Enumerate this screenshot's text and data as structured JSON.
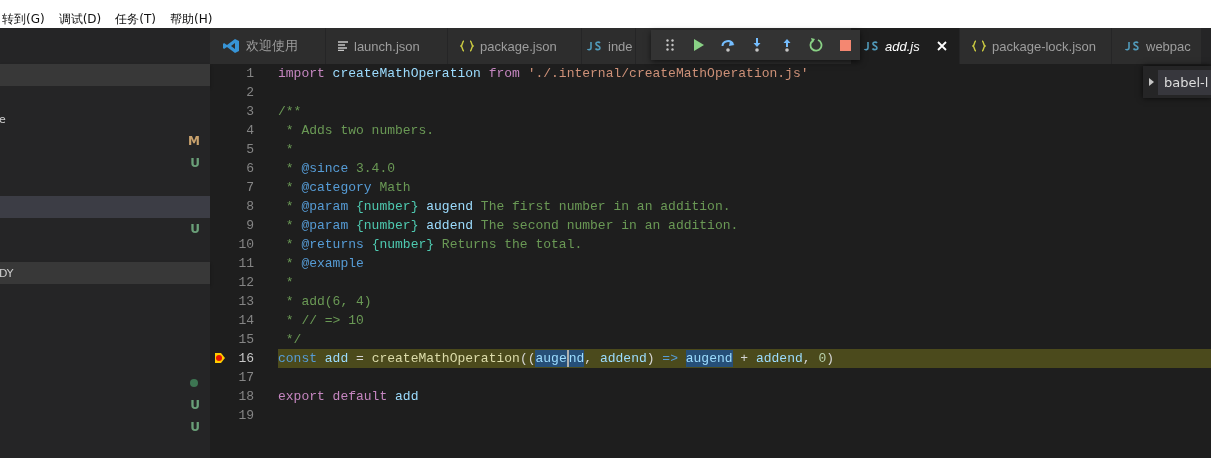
{
  "menu": [
    "转到(G)",
    "调试(D)",
    "任务(T)",
    "帮助(H)"
  ],
  "sidebar": {
    "rows": [
      {
        "kind": "section"
      },
      {
        "kind": "blank"
      },
      {
        "kind": "item",
        "selected": false,
        "text": "e"
      },
      {
        "kind": "item",
        "selected": false,
        "badge": "M",
        "color": "#c9a26d"
      },
      {
        "kind": "item",
        "selected": false,
        "badge": "U",
        "color": "#6a9f78"
      },
      {
        "kind": "blank"
      },
      {
        "kind": "item",
        "selected": true
      },
      {
        "kind": "item",
        "selected": false,
        "badge": "U",
        "color": "#6a9f78"
      },
      {
        "kind": "blank"
      },
      {
        "kind": "section",
        "text": "DY"
      },
      {
        "kind": "blank"
      },
      {
        "kind": "blank"
      },
      {
        "kind": "blank"
      },
      {
        "kind": "blank"
      },
      {
        "kind": "dot",
        "selected": false,
        "color": "#3d7552"
      },
      {
        "kind": "item",
        "selected": false,
        "badge": "U",
        "color": "#6a9f78"
      },
      {
        "kind": "item",
        "selected": false,
        "badge": "U",
        "color": "#6a9f78"
      }
    ]
  },
  "tabs": [
    {
      "label": "欢迎使用",
      "kind": "vscode",
      "selected": false
    },
    {
      "label": "launch.json",
      "kind": "lines",
      "selected": false
    },
    {
      "label": "package.json",
      "kind": "braces",
      "selected": false
    },
    {
      "label": "inde",
      "kind": "js",
      "selected": false
    },
    {
      "label": "add.js",
      "kind": "js",
      "selected": true
    },
    {
      "label": "package-lock.json",
      "kind": "braces",
      "selected": false
    },
    {
      "label": "webpac",
      "kind": "js",
      "selected": false
    }
  ],
  "debug_toolbar": [
    {
      "kind": "grip"
    },
    {
      "kind": "continue"
    },
    {
      "kind": "step-over"
    },
    {
      "kind": "step-into"
    },
    {
      "kind": "step-out"
    },
    {
      "kind": "restart"
    },
    {
      "kind": "stop"
    }
  ],
  "peek": {
    "label": "babel-l"
  },
  "code": [
    {
      "number": "1",
      "tokens": [
        {
          "text": "import",
          "kind": "keyword"
        },
        {
          "text": " createMathOperation",
          "kind": "variable"
        },
        {
          "text": " from",
          "kind": "keyword"
        },
        {
          "text": " './.internal/createMathOperation.js'",
          "kind": "string"
        }
      ]
    },
    {
      "number": "2"
    },
    {
      "number": "3",
      "tokens": [
        {
          "text": "/**",
          "kind": "comment"
        }
      ]
    },
    {
      "number": "4",
      "tokens": [
        {
          "text": " * Adds two numbers.",
          "kind": "comment"
        }
      ]
    },
    {
      "number": "5",
      "tokens": [
        {
          "text": " *",
          "kind": "comment"
        }
      ]
    },
    {
      "number": "6",
      "tokens": [
        {
          "text": " * ",
          "kind": "comment"
        },
        {
          "text": "@since",
          "kind": "tag"
        },
        {
          "text": " 3.4.0",
          "kind": "comment"
        }
      ]
    },
    {
      "number": "7",
      "tokens": [
        {
          "text": " * ",
          "kind": "comment"
        },
        {
          "text": "@category",
          "kind": "tag"
        },
        {
          "text": " Math",
          "kind": "comment"
        }
      ]
    },
    {
      "number": "8",
      "tokens": [
        {
          "text": " * ",
          "kind": "comment"
        },
        {
          "text": "@param",
          "kind": "tag"
        },
        {
          "text": " {number}",
          "kind": "type"
        },
        {
          "text": " augend",
          "kind": "variable"
        },
        {
          "text": " The first number in an addition.",
          "kind": "comment"
        }
      ]
    },
    {
      "number": "9",
      "tokens": [
        {
          "text": " * ",
          "kind": "comment"
        },
        {
          "text": "@param",
          "kind": "tag"
        },
        {
          "text": " {number}",
          "kind": "type"
        },
        {
          "text": " addend",
          "kind": "variable"
        },
        {
          "text": " The second number in an addition.",
          "kind": "comment"
        }
      ]
    },
    {
      "number": "10",
      "tokens": [
        {
          "text": " * ",
          "kind": "comment"
        },
        {
          "text": "@returns",
          "kind": "tag"
        },
        {
          "text": " {number}",
          "kind": "type"
        },
        {
          "text": " Returns the total.",
          "kind": "comment"
        }
      ]
    },
    {
      "number": "11",
      "tokens": [
        {
          "text": " * ",
          "kind": "comment"
        },
        {
          "text": "@example",
          "kind": "tag"
        }
      ]
    },
    {
      "number": "12",
      "tokens": [
        {
          "text": " *",
          "kind": "comment"
        }
      ]
    },
    {
      "number": "13",
      "tokens": [
        {
          "text": " * add(6, 4)",
          "kind": "comment"
        }
      ]
    },
    {
      "number": "14",
      "tokens": [
        {
          "text": " * // => 10",
          "kind": "comment"
        }
      ]
    },
    {
      "number": "15",
      "tokens": [
        {
          "text": " */",
          "kind": "comment"
        }
      ]
    },
    {
      "number": "16",
      "current": true,
      "breakpoint": true,
      "tokens": [
        {
          "text": "const",
          "kind": "storage"
        },
        {
          "text": " add",
          "kind": "variable"
        },
        {
          "text": " = ",
          "kind": "plain"
        },
        {
          "text": "createMathOperation",
          "kind": "function"
        },
        {
          "text": "((",
          "kind": "plain"
        },
        {
          "text": "auge",
          "kind": "variable",
          "highlight": true
        },
        {
          "text": "nd",
          "kind": "variable",
          "highlight": true,
          "cursor": true
        },
        {
          "text": ", ",
          "kind": "plain"
        },
        {
          "text": "addend",
          "kind": "variable"
        },
        {
          "text": ") ",
          "kind": "plain"
        },
        {
          "text": "=> ",
          "kind": "storage"
        },
        {
          "text": "augend",
          "kind": "variable",
          "highlight": true
        },
        {
          "text": " + ",
          "kind": "plain"
        },
        {
          "text": "addend",
          "kind": "variable"
        },
        {
          "text": ", ",
          "kind": "plain"
        },
        {
          "text": "0",
          "kind": "number"
        },
        {
          "text": ")",
          "kind": "plain"
        }
      ]
    },
    {
      "number": "17"
    },
    {
      "number": "18",
      "tokens": [
        {
          "text": "export",
          "kind": "keyword"
        },
        {
          "text": " default",
          "kind": "keyword"
        },
        {
          "text": " add",
          "kind": "variable"
        }
      ]
    },
    {
      "number": "19"
    }
  ]
}
